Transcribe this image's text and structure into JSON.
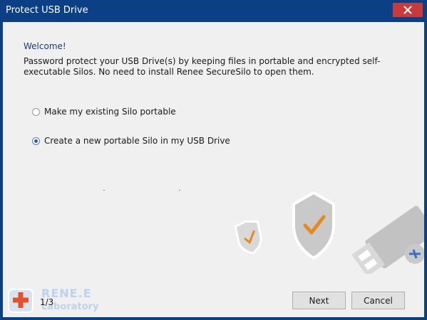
{
  "window": {
    "title": "Protect USB Drive"
  },
  "content": {
    "welcome": "Welcome!",
    "description": "Password protect your USB Drive(s) by keeping files in portable and encrypted self-executable Silos. No need to install Renee SecureSilo to open them.",
    "options": [
      {
        "label": "Make my existing Silo portable",
        "selected": false
      },
      {
        "label": "Create a new portable Silo in my USB Drive",
        "selected": true
      }
    ]
  },
  "footer": {
    "page_indicator": "1/3",
    "next_label": "Next",
    "cancel_label": "Cancel",
    "logo_name": "RENE.E",
    "logo_sub": "Laboratory"
  },
  "colors": {
    "titlebar": "#0b3f86",
    "close": "#c93b3b",
    "accent_orange": "#e8891f"
  }
}
